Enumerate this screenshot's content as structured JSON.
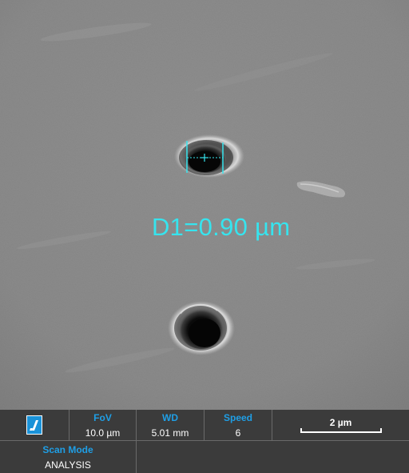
{
  "measurement": {
    "label": "D1=0.90 µm"
  },
  "info_bar": {
    "logo": {
      "icon": "microscope-logo-icon"
    },
    "fov": {
      "label": "FoV",
      "value": "10.0 µm"
    },
    "wd": {
      "label": "WD",
      "value": "5.01 mm"
    },
    "speed": {
      "label": "Speed",
      "value": "6"
    },
    "scale_bar": {
      "label": "2 µm"
    },
    "scan_mode": {
      "label": "Scan Mode",
      "value": "ANALYSIS"
    }
  },
  "colors": {
    "accent_label": "#1f9fe6",
    "measure_overlay": "#36e4ee",
    "bar_background": "#3b3b3b"
  }
}
